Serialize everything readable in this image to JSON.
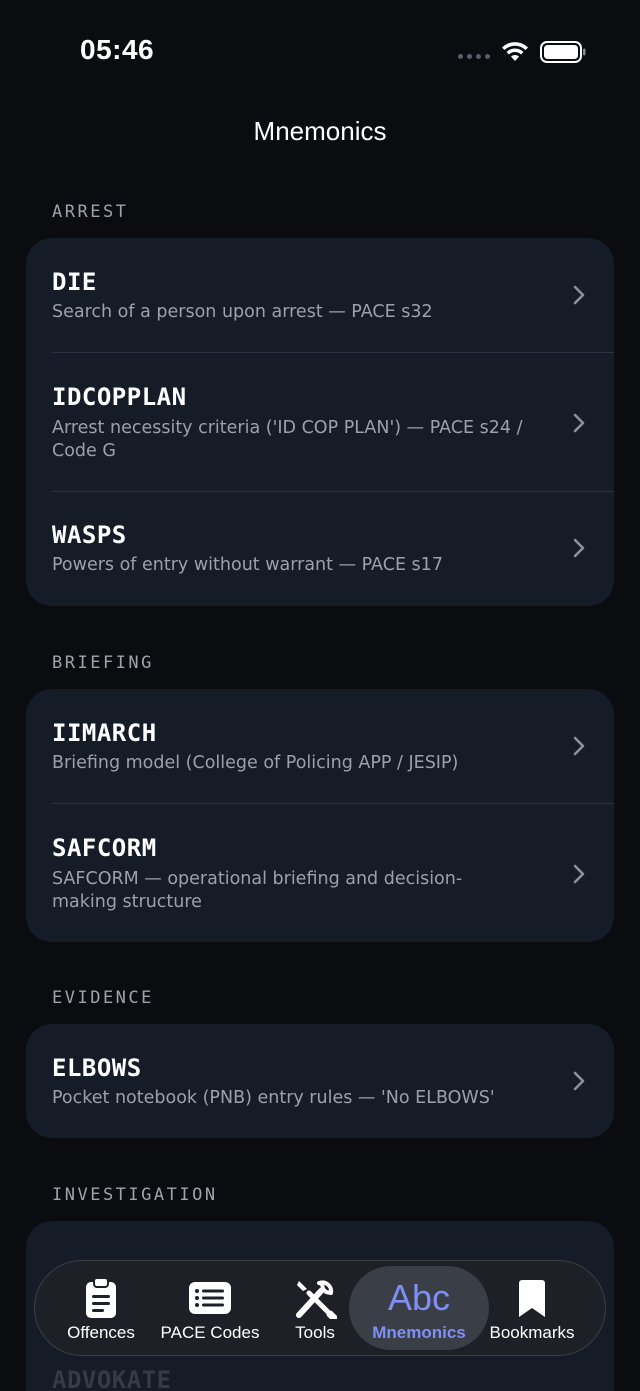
{
  "status": {
    "time": "05:46"
  },
  "title": "Mnemonics",
  "sections": [
    {
      "header": "ARREST",
      "items": [
        {
          "title": "DIE",
          "subtitle": "Search of a person upon arrest — PACE s32"
        },
        {
          "title": "IDCOPPLAN",
          "subtitle_line1": "Arrest necessity criteria ('ID COP PLAN') — PACE s24 /",
          "subtitle_line2": "Code G"
        },
        {
          "title": "WASPS",
          "subtitle": "Powers of entry without warrant — PACE s17"
        }
      ]
    },
    {
      "header": "BRIEFING",
      "items": [
        {
          "title": "IIMARCH",
          "subtitle": "Briefing model (College of Policing APP / JESIP)"
        },
        {
          "title": "SAFCORM",
          "subtitle_line1": "SAFCORM — operational briefing and decision-",
          "subtitle_line2": "making structure"
        }
      ]
    },
    {
      "header": "EVIDENCE",
      "items": [
        {
          "title": "ELBOWS",
          "subtitle": "Pocket notebook (PNB) entry rules — 'No ELBOWS'"
        }
      ]
    },
    {
      "header": "INVESTIGATION",
      "items": [
        {
          "title": "ADVOKATE"
        }
      ]
    }
  ],
  "tabs": [
    {
      "label": "Offences",
      "icon": "clipboard-icon"
    },
    {
      "label": "PACE Codes",
      "icon": "list-card-icon"
    },
    {
      "label": "Tools",
      "icon": "wrench-screwdriver-icon"
    },
    {
      "label": "Mnemonics",
      "icon": "abc-icon",
      "glyph": "Abc",
      "active": true
    },
    {
      "label": "Bookmarks",
      "icon": "bookmark-icon"
    }
  ],
  "colors": {
    "accent": "#7f8ff5",
    "card": "#151b27",
    "background": "#0a0c10"
  }
}
